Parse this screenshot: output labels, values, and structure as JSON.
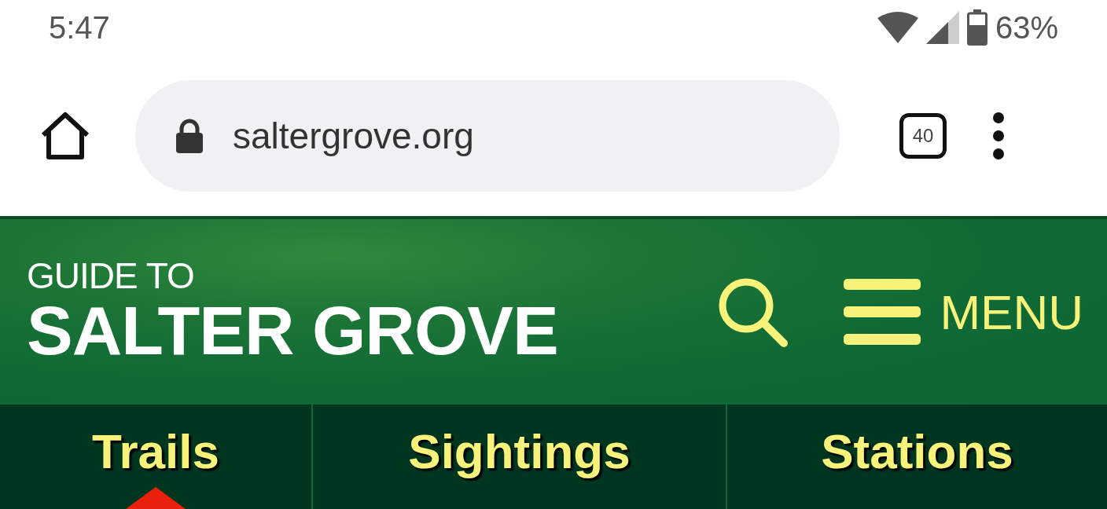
{
  "status_bar": {
    "time": "5:47",
    "battery": "63%"
  },
  "browser": {
    "url": "saltergrove.org",
    "tab_count": "40"
  },
  "header": {
    "kicker": "GUIDE TO",
    "title": "SALTER GROVE",
    "menu_label": "MENU"
  },
  "nav": {
    "tabs": [
      {
        "label": "Trails"
      },
      {
        "label": "Sightings"
      },
      {
        "label": "Stations"
      }
    ]
  }
}
